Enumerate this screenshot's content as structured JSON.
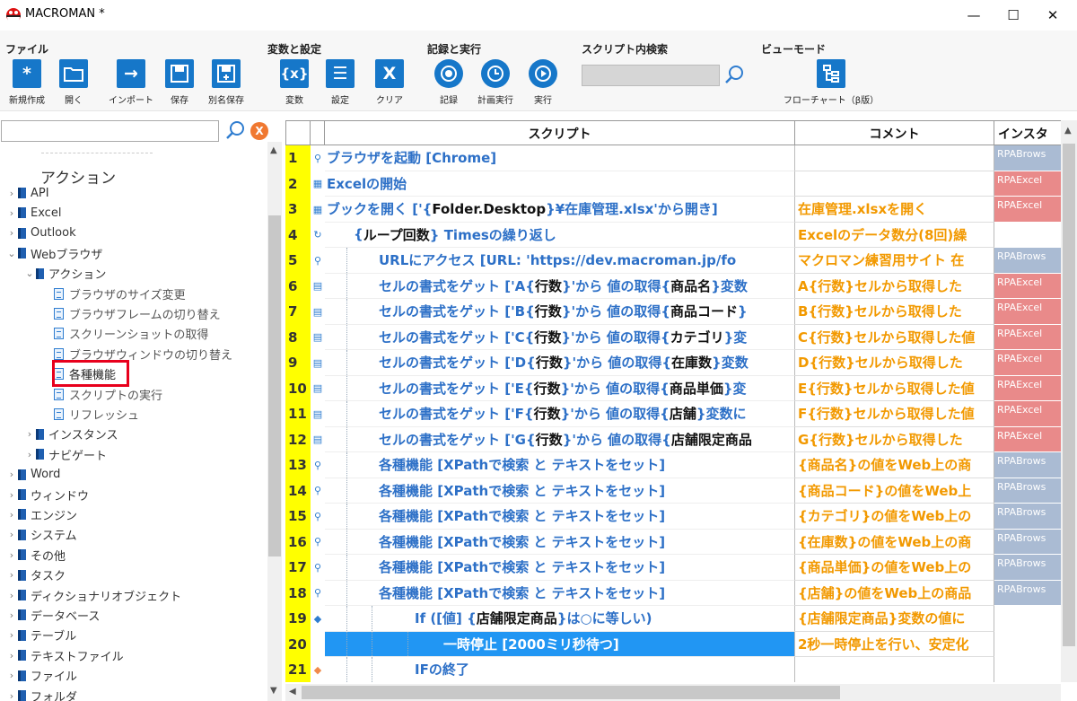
{
  "window": {
    "title": "MACROMAN *",
    "minimize": "—",
    "maximize": "☐",
    "close": "✕"
  },
  "ribbon": {
    "file": {
      "title": "ファイル",
      "new": "新規作成",
      "open": "開く",
      "import": "インポート",
      "save": "保存",
      "save_as": "別名保存"
    },
    "vars": {
      "title": "変数と設定",
      "variables": "変数",
      "settings": "設定",
      "clear": "クリア"
    },
    "record": {
      "title": "記録と実行",
      "record": "記録",
      "schedule": "計画実行",
      "run": "実行"
    },
    "search": {
      "title": "スクリプト内検索",
      "value": ""
    },
    "view": {
      "title": "ビューモード",
      "flowchart": "フローチャート（β版）"
    },
    "icon_glyphs": {
      "new": "*",
      "vars": "{x}",
      "settings": "☰",
      "clear": "X",
      "import": "→"
    }
  },
  "tree": {
    "search_value": "",
    "clear_label": "X",
    "header": "アクション",
    "nodes": [
      {
        "label": "API",
        "level": 0,
        "expanded": false
      },
      {
        "label": "Excel",
        "level": 0,
        "expanded": false
      },
      {
        "label": "Outlook",
        "level": 0,
        "expanded": false
      },
      {
        "label": "Webブラウザ",
        "level": 0,
        "expanded": true
      },
      {
        "label": "アクション",
        "level": 1,
        "expanded": true
      },
      {
        "label": "ブラウザのサイズ変更",
        "level": 2,
        "leaf": true
      },
      {
        "label": "ブラウザフレームの切り替え",
        "level": 2,
        "leaf": true
      },
      {
        "label": "スクリーンショットの取得",
        "level": 2,
        "leaf": true
      },
      {
        "label": "ブラウザウィンドウの切り替え",
        "level": 2,
        "leaf": true
      },
      {
        "label": "各種機能",
        "level": 2,
        "leaf": true,
        "highlighted": true
      },
      {
        "label": "スクリプトの実行",
        "level": 2,
        "leaf": true
      },
      {
        "label": "リフレッシュ",
        "level": 2,
        "leaf": true
      },
      {
        "label": "インスタンス",
        "level": 1,
        "expanded": false
      },
      {
        "label": "ナビゲート",
        "level": 1,
        "expanded": false
      },
      {
        "label": "Word",
        "level": 0,
        "expanded": false
      },
      {
        "label": "ウィンドウ",
        "level": 0,
        "expanded": false
      },
      {
        "label": "エンジン",
        "level": 0,
        "expanded": false
      },
      {
        "label": "システム",
        "level": 0,
        "expanded": false
      },
      {
        "label": "その他",
        "level": 0,
        "expanded": false
      },
      {
        "label": "タスク",
        "level": 0,
        "expanded": false
      },
      {
        "label": "ディクショナリオブジェクト",
        "level": 0,
        "expanded": false
      },
      {
        "label": "データベース",
        "level": 0,
        "expanded": false
      },
      {
        "label": "テーブル",
        "level": 0,
        "expanded": false
      },
      {
        "label": "テキストファイル",
        "level": 0,
        "expanded": false
      },
      {
        "label": "ファイル",
        "level": 0,
        "expanded": false
      },
      {
        "label": "フォルダ",
        "level": 0,
        "expanded": false
      }
    ]
  },
  "grid": {
    "headers": {
      "script": "スクリプト",
      "comment": "コメント",
      "instance": "インスタ"
    },
    "rows": [
      {
        "num": "1",
        "icon": "⚲",
        "indent": 0,
        "parts": [
          [
            "ブラウザを起動 [Chrome]",
            "b"
          ]
        ],
        "comment": "",
        "inst": "RPABrows",
        "inst_color": "blue"
      },
      {
        "num": "2",
        "icon": "▦",
        "indent": 0,
        "parts": [
          [
            "Excelの開始",
            "b"
          ]
        ],
        "comment": "",
        "inst": "RPAExcel",
        "inst_color": "red"
      },
      {
        "num": "3",
        "icon": "▦",
        "indent": 0,
        "parts": [
          [
            "ブックを開く ['{",
            "b"
          ],
          [
            "Folder.Desktop",
            "k"
          ],
          [
            "}¥在庫管理.xlsx'から開き]",
            "b"
          ]
        ],
        "comment": "在庫管理.xlsxを開く",
        "inst": "RPAExcel",
        "inst_color": "red"
      },
      {
        "num": "4",
        "icon": "↻",
        "indent": 1,
        "parts": [
          [
            "{",
            "b"
          ],
          [
            "ループ回数",
            "k"
          ],
          [
            "} Timesの繰り返し",
            "b"
          ]
        ],
        "comment": "Excelのデータ数分(8回)繰",
        "inst": "",
        "inst_color": "none"
      },
      {
        "num": "5",
        "icon": "⚲",
        "indent": 2,
        "parts": [
          [
            "URLにアクセス [URL: 'https://dev.macroman.jp/fo",
            "b"
          ]
        ],
        "comment": "マクロマン練習用サイト 在",
        "inst": "RPABrows",
        "inst_color": "blue"
      },
      {
        "num": "6",
        "icon": "▤",
        "indent": 2,
        "parts": [
          [
            "セルの書式をゲット ['A{",
            "b"
          ],
          [
            "行数",
            "k"
          ],
          [
            "}'から 値の取得{",
            "b"
          ],
          [
            "商品名",
            "k"
          ],
          [
            "}変数",
            "b"
          ]
        ],
        "comment": "A{行数}セルから取得した",
        "inst": "RPAExcel",
        "inst_color": "red"
      },
      {
        "num": "7",
        "icon": "▤",
        "indent": 2,
        "parts": [
          [
            "セルの書式をゲット ['B{",
            "b"
          ],
          [
            "行数",
            "k"
          ],
          [
            "}'から 値の取得{",
            "b"
          ],
          [
            "商品コード",
            "k"
          ],
          [
            "}",
            "b"
          ]
        ],
        "comment": "B{行数}セルから取得した",
        "inst": "RPAExcel",
        "inst_color": "red"
      },
      {
        "num": "8",
        "icon": "▤",
        "indent": 2,
        "parts": [
          [
            "セルの書式をゲット ['C{",
            "b"
          ],
          [
            "行数",
            "k"
          ],
          [
            "}'から 値の取得{",
            "b"
          ],
          [
            "カテゴリ",
            "k"
          ],
          [
            "}変",
            "b"
          ]
        ],
        "comment": "C{行数}セルから取得した値",
        "inst": "RPAExcel",
        "inst_color": "red"
      },
      {
        "num": "9",
        "icon": "▤",
        "indent": 2,
        "parts": [
          [
            "セルの書式をゲット ['D{",
            "b"
          ],
          [
            "行数",
            "k"
          ],
          [
            "}'から 値の取得{",
            "b"
          ],
          [
            "在庫数",
            "k"
          ],
          [
            "}変数",
            "b"
          ]
        ],
        "comment": "D{行数}セルから取得した",
        "inst": "RPAExcel",
        "inst_color": "red"
      },
      {
        "num": "10",
        "icon": "▤",
        "indent": 2,
        "parts": [
          [
            "セルの書式をゲット ['E{",
            "b"
          ],
          [
            "行数",
            "k"
          ],
          [
            "}'から 値の取得{",
            "b"
          ],
          [
            "商品単価",
            "k"
          ],
          [
            "}変",
            "b"
          ]
        ],
        "comment": "E{行数}セルから取得した値",
        "inst": "RPAExcel",
        "inst_color": "red"
      },
      {
        "num": "11",
        "icon": "▤",
        "indent": 2,
        "parts": [
          [
            "セルの書式をゲット ['F{",
            "b"
          ],
          [
            "行数",
            "k"
          ],
          [
            "}'から 値の取得{",
            "b"
          ],
          [
            "店舗",
            "k"
          ],
          [
            "}変数に",
            "b"
          ]
        ],
        "comment": "F{行数}セルから取得した値",
        "inst": "RPAExcel",
        "inst_color": "red"
      },
      {
        "num": "12",
        "icon": "▤",
        "indent": 2,
        "parts": [
          [
            "セルの書式をゲット ['G{",
            "b"
          ],
          [
            "行数",
            "k"
          ],
          [
            "}'から 値の取得{",
            "b"
          ],
          [
            "店舗限定商品",
            "k"
          ]
        ],
        "comment": "G{行数}セルから取得した",
        "inst": "RPAExcel",
        "inst_color": "red"
      },
      {
        "num": "13",
        "icon": "⚲",
        "indent": 2,
        "parts": [
          [
            "各種機能 [XPathで検索 と テキストをセット]",
            "b"
          ]
        ],
        "comment": "{商品名}の値をWeb上の商",
        "inst": "RPABrows",
        "inst_color": "blue"
      },
      {
        "num": "14",
        "icon": "⚲",
        "indent": 2,
        "parts": [
          [
            "各種機能 [XPathで検索 と テキストをセット]",
            "b"
          ]
        ],
        "comment": "{商品コード}の値をWeb上",
        "inst": "RPABrows",
        "inst_color": "blue"
      },
      {
        "num": "15",
        "icon": "⚲",
        "indent": 2,
        "parts": [
          [
            "各種機能 [XPathで検索 と テキストをセット]",
            "b"
          ]
        ],
        "comment": "{カテゴリ}の値をWeb上の",
        "inst": "RPABrows",
        "inst_color": "blue"
      },
      {
        "num": "16",
        "icon": "⚲",
        "indent": 2,
        "parts": [
          [
            "各種機能 [XPathで検索 と テキストをセット]",
            "b"
          ]
        ],
        "comment": "{在庫数}の値をWeb上の商",
        "inst": "RPABrows",
        "inst_color": "blue"
      },
      {
        "num": "17",
        "icon": "⚲",
        "indent": 2,
        "parts": [
          [
            "各種機能 [XPathで検索 と テキストをセット]",
            "b"
          ]
        ],
        "comment": "{商品単価}の値をWeb上の",
        "inst": "RPABrows",
        "inst_color": "blue"
      },
      {
        "num": "18",
        "icon": "⚲",
        "indent": 2,
        "parts": [
          [
            "各種機能 [XPathで検索 と テキストをセット]",
            "b"
          ]
        ],
        "comment": "{店舗}の値をWeb上の商品",
        "inst": "RPABrows",
        "inst_color": "blue"
      },
      {
        "num": "19",
        "icon": "◆",
        "indent": 3,
        "parts": [
          [
            "If ([値] {",
            "b"
          ],
          [
            "店舗限定商品",
            "k"
          ],
          [
            "}は○に等しい)",
            "b"
          ]
        ],
        "comment": "{店舗限定商品}変数の値に",
        "inst": "",
        "inst_color": "none"
      },
      {
        "num": "20",
        "icon": "Ⅱ",
        "indent": 4,
        "parts": [
          [
            "一時停止 [2000ミリ秒待つ]",
            "b"
          ]
        ],
        "comment": "2秒一時停止を行い、安定化",
        "inst": "",
        "inst_color": "none",
        "selected": true
      },
      {
        "num": "21",
        "icon": "◆",
        "indent": 3,
        "parts": [
          [
            "IFの終了",
            "b"
          ]
        ],
        "comment": "",
        "inst": "",
        "inst_color": "none"
      }
    ]
  },
  "colors": {
    "accent": "#1677c9",
    "selection": "#2196f3",
    "linenum": "#ffff00",
    "script_text": "#2d70c7",
    "comment_text": "#f29900",
    "inst_blue": "#aabbd3",
    "inst_red": "#e98a8a",
    "highlight_box": "#e8001c"
  }
}
